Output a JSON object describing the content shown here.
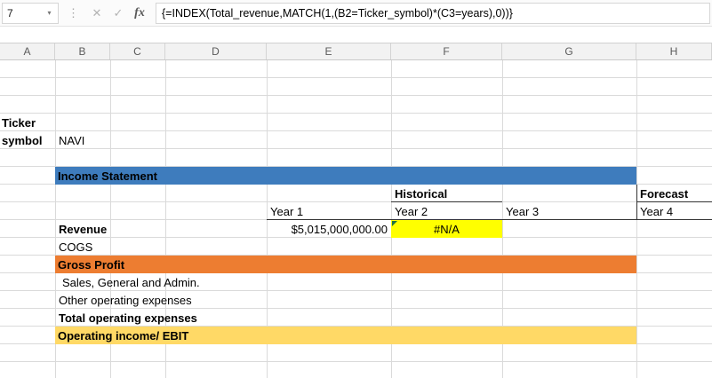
{
  "formula_bar": {
    "name_box": "7",
    "dropdown_icon": "▾",
    "splitter_icon": "⋮",
    "cancel_icon": "✕",
    "enter_icon": "✓",
    "fx_label": "fx",
    "formula": "{=INDEX(Total_revenue,MATCH(1,(B2=Ticker_symbol)*(C3=years),0))}"
  },
  "columns": [
    "A",
    "B",
    "C",
    "D",
    "E",
    "F",
    "G",
    "H"
  ],
  "cells": {
    "ticker_label_line1": "Ticker",
    "ticker_label_line2": "symbol",
    "ticker_value": "NAVI",
    "income_statement": "Income Statement",
    "historical": "Historical",
    "forecast": "Forecast",
    "year1": "Year 1",
    "year2": "Year 2",
    "year3": "Year 3",
    "year4": "Year 4",
    "revenue_label": "Revenue",
    "revenue_year1": "$5,015,000,000.00",
    "revenue_year2": "#N/A",
    "cogs": "COGS",
    "gross_profit": "Gross Profit",
    "sga": "Sales, General and Admin.",
    "other_opex": "Other operating expenses",
    "total_opex": "Total operating expenses",
    "operating_income": "Operating income/ EBIT"
  },
  "colors": {
    "banner_blue": "#3E7CBD",
    "banner_orange": "#ED7D31",
    "banner_gold": "#FFD966",
    "highlight_yellow": "#FFFF00"
  }
}
